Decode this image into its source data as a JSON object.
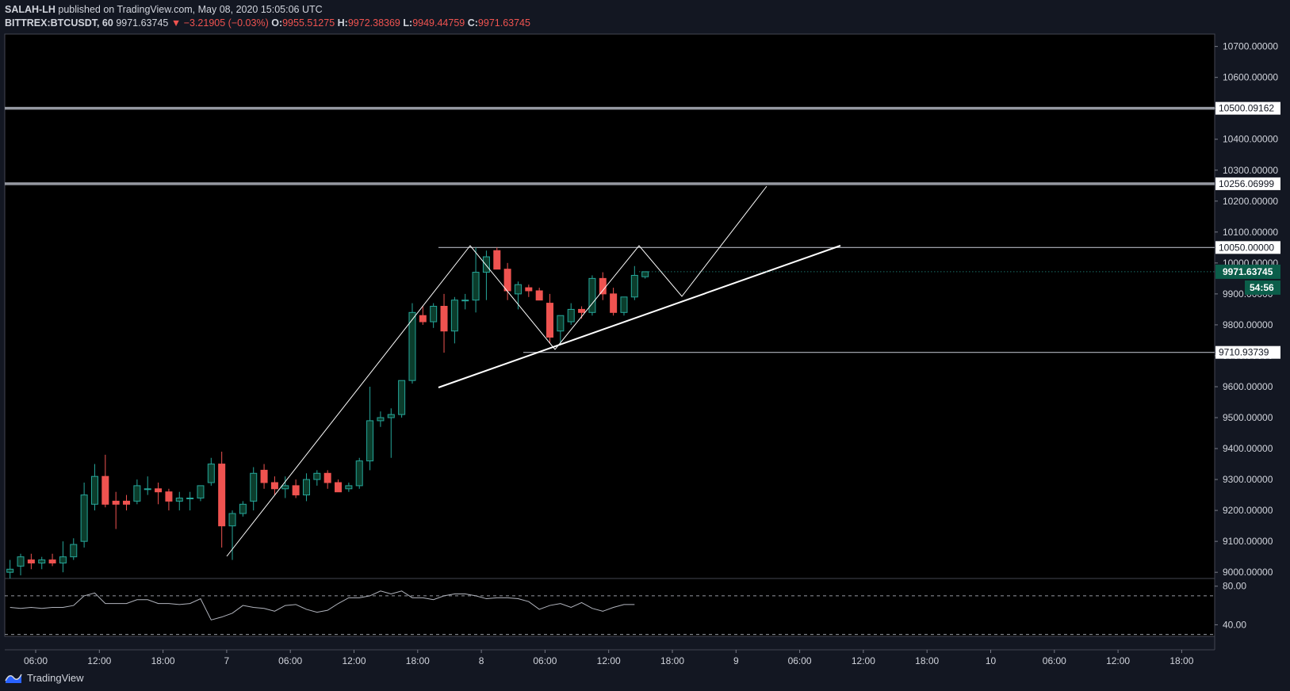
{
  "header": {
    "author": "SALAH-LH",
    "published": " published on TradingView.com, May 08, 2020 15:05:06 UTC"
  },
  "ohlc": {
    "symbol": "BITTREX:BTCUSDT, 60",
    "last": "9971.63745",
    "arrow": "▼",
    "change": "−3.21905 (−0.03%)",
    "o_label": "O:",
    "o": "9955.51275",
    "h_label": "H:",
    "h": "9972.38369",
    "l_label": "L:",
    "l": "9949.44759",
    "c_label": "C:",
    "c": "9971.63745"
  },
  "footer": {
    "brand": "TradingView"
  },
  "colors": {
    "background": "#131722",
    "up": "#26a69a",
    "up_fill": "#0b3d2c",
    "down": "#ef5350",
    "grid": "#1e222d",
    "text": "#d1d4dc",
    "drawing": "#ffffff",
    "price_tag_bg": "#0b5e4a"
  },
  "chart_data": [
    {
      "type": "candlestick",
      "title": "",
      "ylim": [
        8980,
        10740
      ],
      "price_ticks": [
        "9000.00000",
        "9100.00000",
        "9200.00000",
        "9300.00000",
        "9400.00000",
        "9500.00000",
        "9600.00000",
        "9700.00000",
        "9800.00000",
        "9900.00000",
        "10000.00000",
        "10100.00000",
        "10200.00000",
        "10300.00000",
        "10400.00000",
        "10500.00000",
        "10600.00000",
        "10700.00000"
      ],
      "time_ticks": [
        "06:00",
        "12:00",
        "18:00",
        "7",
        "06:00",
        "12:00",
        "18:00",
        "8",
        "06:00",
        "12:00",
        "18:00",
        "9",
        "06:00",
        "12:00",
        "18:00",
        "10",
        "06:00",
        "12:00",
        "18:00"
      ],
      "candles": [
        {
          "o": 9000,
          "h": 9040,
          "l": 8980,
          "c": 9010
        },
        {
          "o": 9020,
          "h": 9060,
          "l": 8990,
          "c": 9050
        },
        {
          "o": 9040,
          "h": 9060,
          "l": 9010,
          "c": 9030
        },
        {
          "o": 9030,
          "h": 9050,
          "l": 9010,
          "c": 9040
        },
        {
          "o": 9040,
          "h": 9060,
          "l": 9020,
          "c": 9030
        },
        {
          "o": 9030,
          "h": 9100,
          "l": 9000,
          "c": 9050
        },
        {
          "o": 9050,
          "h": 9110,
          "l": 9040,
          "c": 9090
        },
        {
          "o": 9100,
          "h": 9290,
          "l": 9080,
          "c": 9250
        },
        {
          "o": 9220,
          "h": 9350,
          "l": 9200,
          "c": 9310
        },
        {
          "o": 9310,
          "h": 9380,
          "l": 9210,
          "c": 9220
        },
        {
          "o": 9230,
          "h": 9260,
          "l": 9140,
          "c": 9220
        },
        {
          "o": 9230,
          "h": 9250,
          "l": 9200,
          "c": 9220
        },
        {
          "o": 9230,
          "h": 9300,
          "l": 9220,
          "c": 9280
        },
        {
          "o": 9270,
          "h": 9310,
          "l": 9250,
          "c": 9270
        },
        {
          "o": 9270,
          "h": 9290,
          "l": 9220,
          "c": 9260
        },
        {
          "o": 9260,
          "h": 9270,
          "l": 9200,
          "c": 9230
        },
        {
          "o": 9230,
          "h": 9260,
          "l": 9200,
          "c": 9240
        },
        {
          "o": 9240,
          "h": 9260,
          "l": 9200,
          "c": 9240
        },
        {
          "o": 9240,
          "h": 9280,
          "l": 9230,
          "c": 9280
        },
        {
          "o": 9290,
          "h": 9370,
          "l": 9280,
          "c": 9350
        },
        {
          "o": 9350,
          "h": 9390,
          "l": 9080,
          "c": 9150
        },
        {
          "o": 9150,
          "h": 9200,
          "l": 9040,
          "c": 9190
        },
        {
          "o": 9190,
          "h": 9230,
          "l": 9180,
          "c": 9220
        },
        {
          "o": 9230,
          "h": 9340,
          "l": 9200,
          "c": 9320
        },
        {
          "o": 9330,
          "h": 9350,
          "l": 9270,
          "c": 9290
        },
        {
          "o": 9290,
          "h": 9310,
          "l": 9250,
          "c": 9270
        },
        {
          "o": 9270,
          "h": 9310,
          "l": 9240,
          "c": 9280
        },
        {
          "o": 9280,
          "h": 9300,
          "l": 9240,
          "c": 9250
        },
        {
          "o": 9250,
          "h": 9320,
          "l": 9230,
          "c": 9300
        },
        {
          "o": 9300,
          "h": 9330,
          "l": 9280,
          "c": 9320
        },
        {
          "o": 9320,
          "h": 9330,
          "l": 9270,
          "c": 9290
        },
        {
          "o": 9290,
          "h": 9300,
          "l": 9260,
          "c": 9260
        },
        {
          "o": 9270,
          "h": 9290,
          "l": 9260,
          "c": 9280
        },
        {
          "o": 9280,
          "h": 9370,
          "l": 9270,
          "c": 9360
        },
        {
          "o": 9360,
          "h": 9600,
          "l": 9330,
          "c": 9490
        },
        {
          "o": 9490,
          "h": 9520,
          "l": 9470,
          "c": 9500
        },
        {
          "o": 9500,
          "h": 9530,
          "l": 9370,
          "c": 9510
        },
        {
          "o": 9510,
          "h": 9620,
          "l": 9500,
          "c": 9620
        },
        {
          "o": 9620,
          "h": 9870,
          "l": 9610,
          "c": 9840
        },
        {
          "o": 9830,
          "h": 9860,
          "l": 9800,
          "c": 9810
        },
        {
          "o": 9810,
          "h": 9870,
          "l": 9790,
          "c": 9860
        },
        {
          "o": 9860,
          "h": 9900,
          "l": 9710,
          "c": 9780
        },
        {
          "o": 9780,
          "h": 9890,
          "l": 9740,
          "c": 9880
        },
        {
          "o": 9880,
          "h": 9900,
          "l": 9850,
          "c": 9880
        },
        {
          "o": 9880,
          "h": 10050,
          "l": 9840,
          "c": 9970
        },
        {
          "o": 9970,
          "h": 10040,
          "l": 9880,
          "c": 10020
        },
        {
          "o": 10040,
          "h": 10050,
          "l": 9980,
          "c": 9980
        },
        {
          "o": 9980,
          "h": 10000,
          "l": 9880,
          "c": 9910
        },
        {
          "o": 9900,
          "h": 9940,
          "l": 9850,
          "c": 9930
        },
        {
          "o": 9920,
          "h": 9930,
          "l": 9890,
          "c": 9910
        },
        {
          "o": 9910,
          "h": 9920,
          "l": 9880,
          "c": 9880
        },
        {
          "o": 9870,
          "h": 9900,
          "l": 9740,
          "c": 9760
        },
        {
          "o": 9780,
          "h": 9830,
          "l": 9740,
          "c": 9830
        },
        {
          "o": 9810,
          "h": 9870,
          "l": 9800,
          "c": 9850
        },
        {
          "o": 9850,
          "h": 9860,
          "l": 9820,
          "c": 9840
        },
        {
          "o": 9840,
          "h": 9960,
          "l": 9830,
          "c": 9950
        },
        {
          "o": 9950,
          "h": 9970,
          "l": 9880,
          "c": 9900
        },
        {
          "o": 9900,
          "h": 9920,
          "l": 9830,
          "c": 9840
        },
        {
          "o": 9840,
          "h": 9890,
          "l": 9830,
          "c": 9890
        },
        {
          "o": 9890,
          "h": 9990,
          "l": 9880,
          "c": 9960
        },
        {
          "o": 9955.51,
          "h": 9972.38,
          "l": 9949.45,
          "c": 9971.64
        }
      ],
      "horizontal_levels": [
        {
          "price": 10500.09162,
          "label": "10500.09162",
          "thick": true
        },
        {
          "price": 10256.06999,
          "label": "10256.06999",
          "thick": true
        },
        {
          "price": 10050.0,
          "label": "10050.00000",
          "thick": false
        },
        {
          "price": 9710.93739,
          "label": "9710.93739",
          "thick": false
        }
      ],
      "last_price": {
        "label": "9971.63745",
        "countdown": "54:56"
      }
    },
    {
      "type": "line",
      "title": "",
      "ylim": [
        28,
        88
      ],
      "ticks": [
        "80.00",
        "40.00"
      ],
      "bands": [
        70,
        30
      ],
      "values": [
        58,
        57,
        58,
        57,
        58,
        58,
        60,
        70,
        73,
        62,
        62,
        62,
        66,
        66,
        62,
        62,
        61,
        62,
        67,
        45,
        48,
        52,
        60,
        58,
        57,
        54,
        60,
        61,
        56,
        53,
        55,
        62,
        68,
        68,
        70,
        75,
        72,
        75,
        68,
        68,
        66,
        70,
        72,
        72,
        70,
        67,
        68,
        68,
        67,
        64,
        56,
        60,
        62,
        58,
        63,
        57,
        54,
        58,
        61,
        61
      ]
    }
  ]
}
